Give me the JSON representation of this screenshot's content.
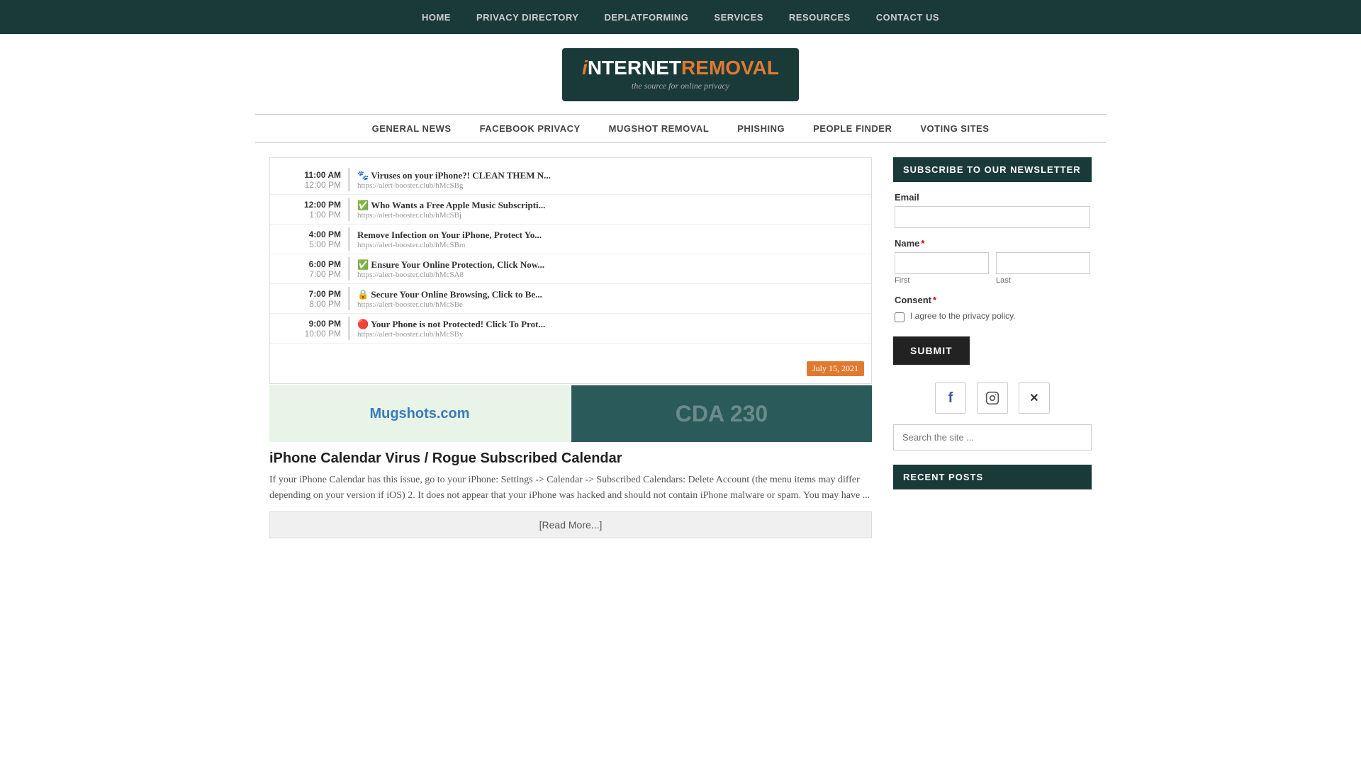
{
  "topNav": {
    "items": [
      {
        "label": "HOME",
        "href": "#"
      },
      {
        "label": "PRIVACY DIRECTORY",
        "href": "#"
      },
      {
        "label": "DEPLATFORMING",
        "href": "#"
      },
      {
        "label": "SERVICES",
        "href": "#"
      },
      {
        "label": "RESOURCES",
        "href": "#"
      },
      {
        "label": "CONTACT US",
        "href": "#"
      }
    ]
  },
  "logo": {
    "i_letter": "i",
    "internet": "NTERNET",
    "removal": "REMOVAL",
    "tagline": "the source for online privacy"
  },
  "secNav": {
    "items": [
      {
        "label": "GENERAL NEWS",
        "href": "#"
      },
      {
        "label": "FACEBOOK PRIVACY",
        "href": "#"
      },
      {
        "label": "MUGSHOT REMOVAL",
        "href": "#"
      },
      {
        "label": "PHISHING",
        "href": "#"
      },
      {
        "label": "PEOPLE FINDER",
        "href": "#"
      },
      {
        "label": "VOTING SITES",
        "href": "#"
      }
    ]
  },
  "calendarRows": [
    {
      "start": "11:00 AM",
      "end": "12:00 PM",
      "emoji": "🐾",
      "title": "Viruses on your iPhone?! CLEAN THEM N...",
      "url": "https://alert-booster.club/hMcSBg"
    },
    {
      "start": "12:00 PM",
      "end": "1:00 PM",
      "emoji": "✅",
      "title": "Who Wants a Free Apple Music Subscripti...",
      "url": "https://alert-booster.club/hMcSBj"
    },
    {
      "start": "4:00 PM",
      "end": "5:00 PM",
      "emoji": "",
      "title": "Remove Infection on Your iPhone, Protect Yo...",
      "url": "https://alert-booster.club/hMcSBm"
    },
    {
      "start": "6:00 PM",
      "end": "7:00 PM",
      "emoji": "✅",
      "title": "Ensure Your Online Protection, Click Now...",
      "url": "https://alert-booster.club/hMcSA8"
    },
    {
      "start": "7:00 PM",
      "end": "8:00 PM",
      "emoji": "🔒",
      "title": "Secure Your Online Browsing, Click to Be...",
      "url": "https://alert-booster.club/hMcSBe"
    },
    {
      "start": "9:00 PM",
      "end": "10:00 PM",
      "emoji": "🔴",
      "title": "Your Phone is not Protected! Click To Prot...",
      "url": "https://alert-booster.club/hMcSBy"
    }
  ],
  "dateBadge": "July 15, 2021",
  "articleTitle": "iPhone Calendar Virus / Rogue Subscribed Calendar",
  "articleExcerpt": "If your iPhone Calendar has this issue, go to your iPhone: Settings -> Calendar -> Subscribed Calendars: Delete Account (the menu items may differ depending on your version if iOS) 2. It does not appear that your iPhone was hacked and should not contain iPhone malware or spam. You may have ...",
  "readMoreLabel": "[Read More...]",
  "sidebar": {
    "newsletterHeading": "SUBSCRIBE TO OUR NEWSLETTER",
    "emailLabel": "Email",
    "nameLabel": "Name",
    "requiredStar": "*",
    "firstPlaceholder": "",
    "lastPlaceholder": "",
    "firstSubLabel": "First",
    "lastSubLabel": "Last",
    "consentLabel": "Consent",
    "consentText": "I agree to the privacy policy.",
    "submitLabel": "SUBMIT",
    "socialIcons": [
      {
        "name": "facebook",
        "symbol": "f"
      },
      {
        "name": "instagram",
        "symbol": "📷"
      },
      {
        "name": "twitter-x",
        "symbol": "✕"
      }
    ],
    "searchPlaceholder": "Search the site ...",
    "recentPostsHeading": "RECENT POSTS"
  },
  "mugshotsLogo": "Mugshots.com",
  "cdaText": "CDA 230"
}
